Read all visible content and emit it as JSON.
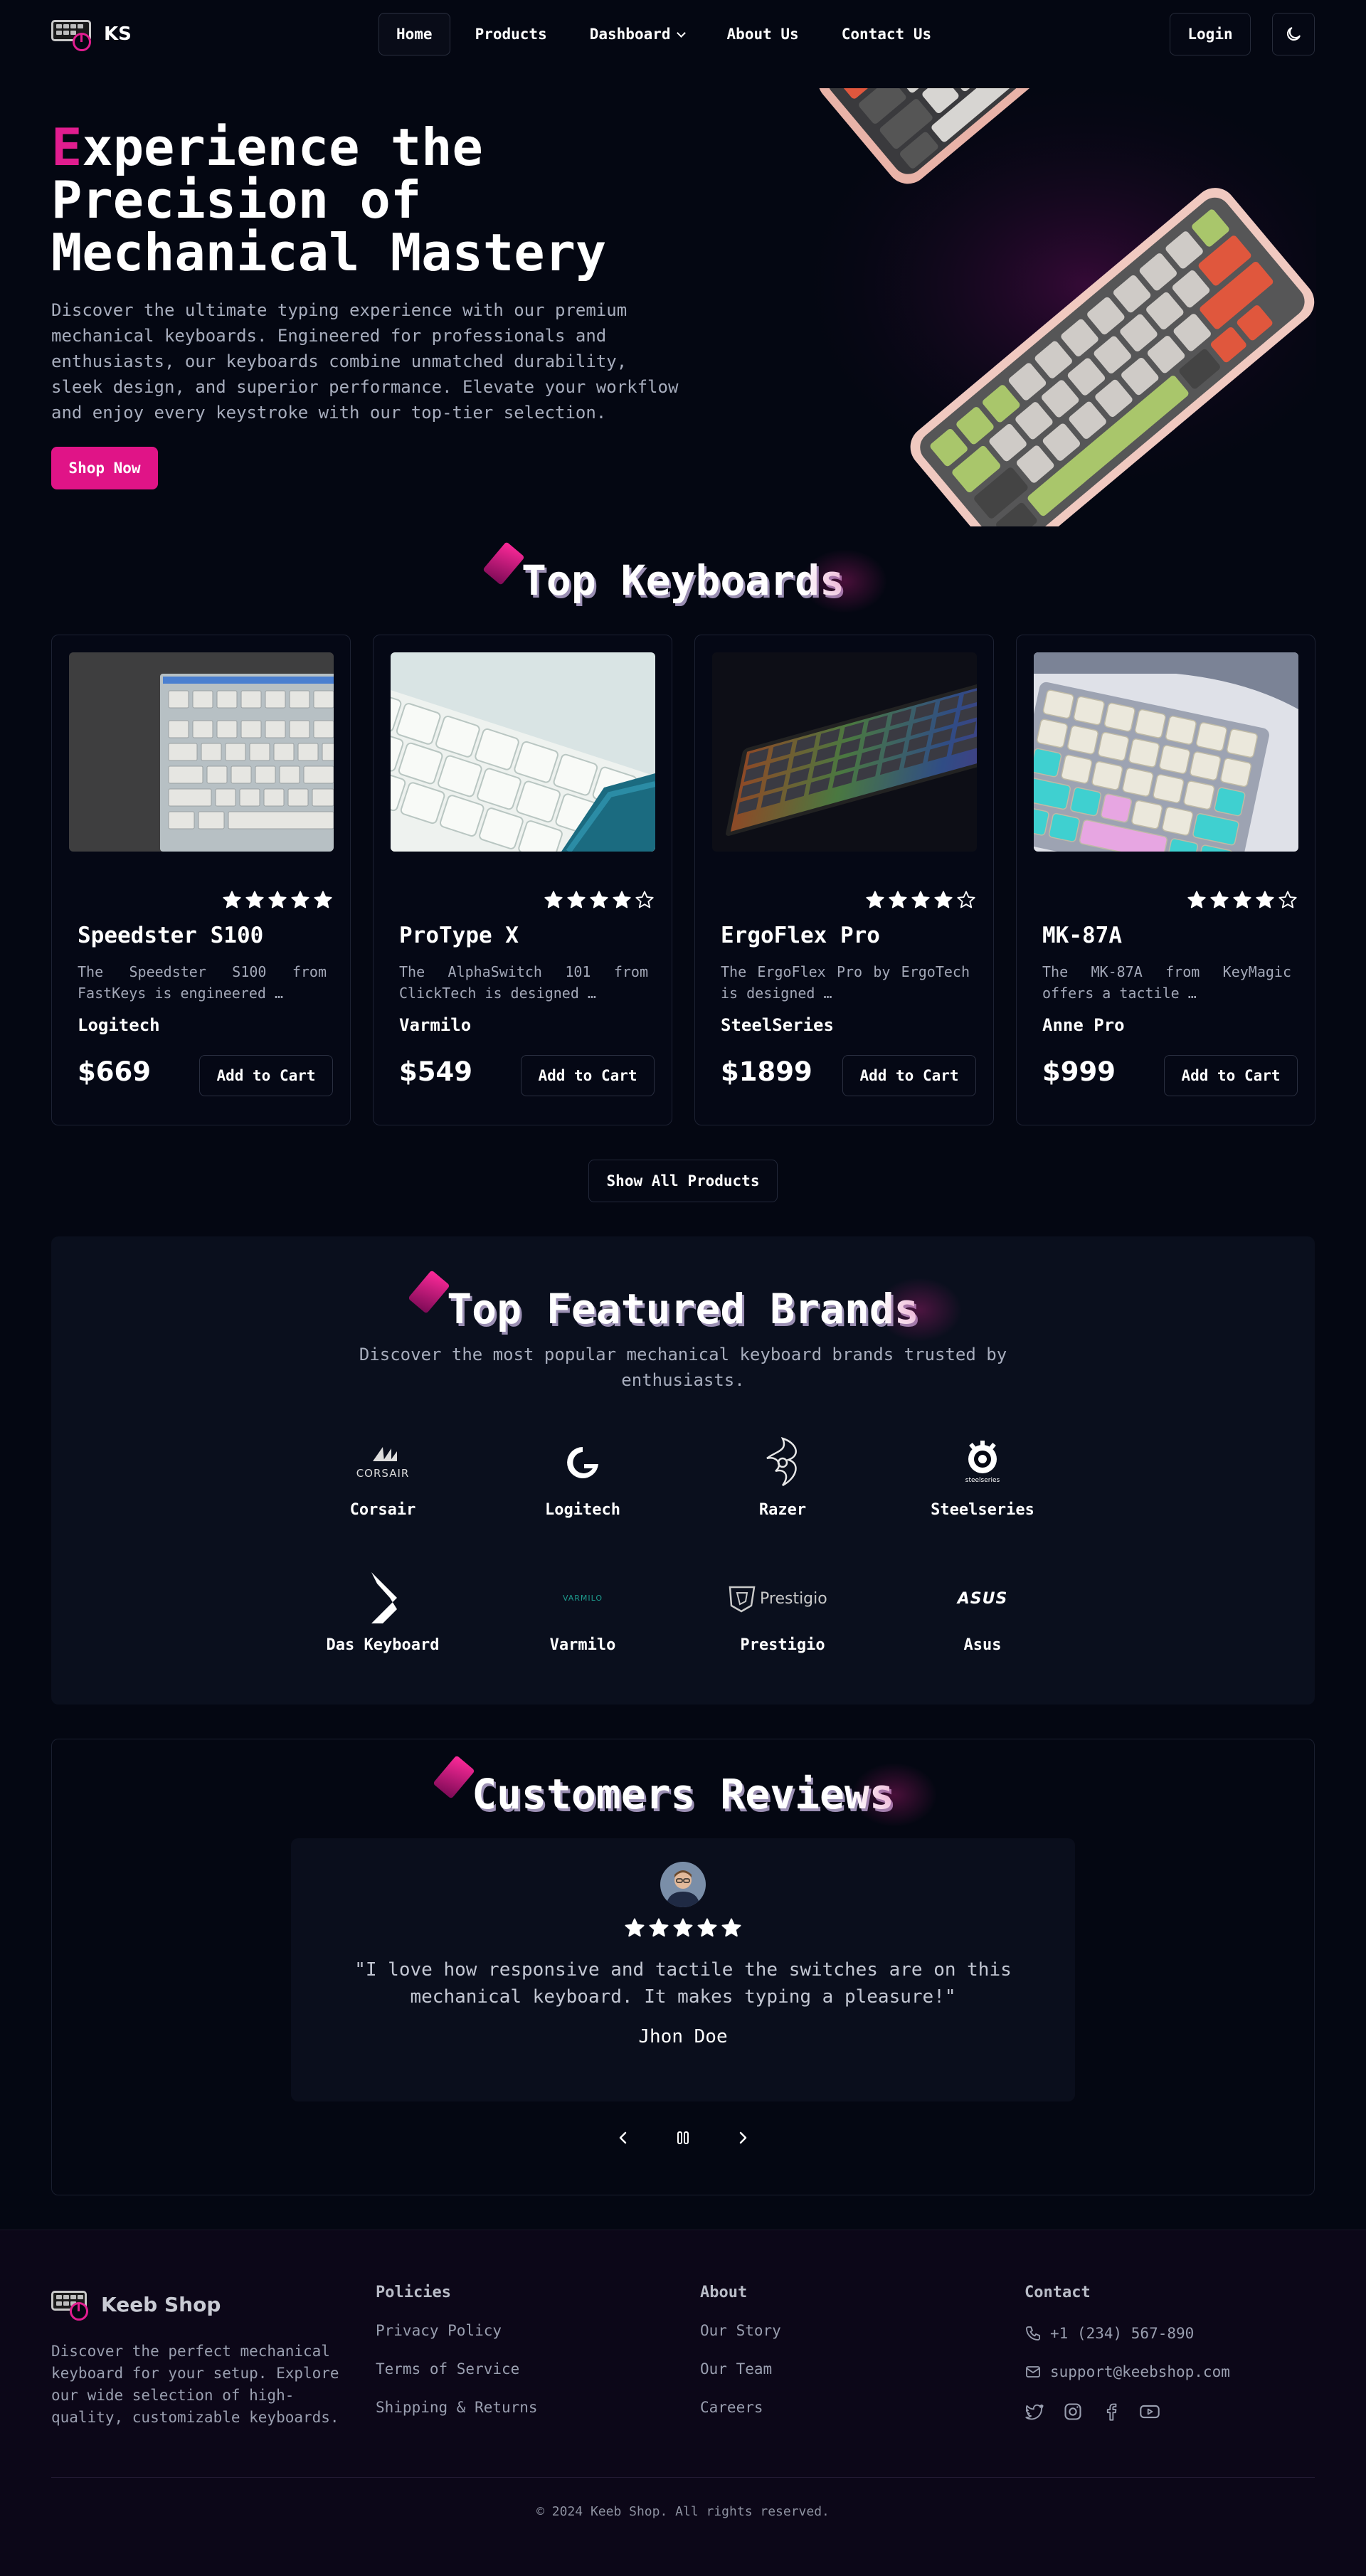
{
  "nav": {
    "brand": "KS",
    "items": [
      {
        "label": "Home"
      },
      {
        "label": "Products"
      },
      {
        "label": "Dashboard"
      },
      {
        "label": "About Us"
      },
      {
        "label": "Contact Us"
      }
    ],
    "login": "Login",
    "theme_icon": "moon-icon"
  },
  "hero": {
    "title_first": "E",
    "title_rest": "xperience the Precision of Mechanical Mastery",
    "description": "Discover the ultimate typing experience with our premium mechanical keyboards. Engineered for professionals and enthusiasts, our keyboards combine unmatched durability, sleek design, and superior performance. Elevate your workflow and enjoy every keystroke with our top-tier selection.",
    "cta": "Shop Now"
  },
  "products": {
    "title": "Top Keyboards",
    "show_all": "Show All Products",
    "cart_label": "Add to Cart",
    "items": [
      {
        "name": "Speedster S100",
        "desc": "The Speedster S100 from FastKeys is engineered …",
        "brand": "Logitech",
        "price": "$669",
        "rating": 5
      },
      {
        "name": "ProType X",
        "desc": "The AlphaSwitch 101 from ClickTech is designed …",
        "brand": "Varmilo",
        "price": "$549",
        "rating": 4
      },
      {
        "name": "ErgoFlex Pro",
        "desc": "The ErgoFlex Pro by ErgoTech is designed …",
        "brand": "SteelSeries",
        "price": "$1899",
        "rating": 4
      },
      {
        "name": "MK-87A",
        "desc": "The MK-87A from KeyMagic offers a tactile …",
        "brand": "Anne Pro",
        "price": "$999",
        "rating": 4
      }
    ]
  },
  "brands": {
    "title": "Top Featured Brands",
    "subtitle": "Discover the most popular mechanical keyboard brands trusted by enthusiasts.",
    "items": [
      {
        "name": "Corsair",
        "logo_text": "CORSAIR"
      },
      {
        "name": "Logitech"
      },
      {
        "name": "Razer"
      },
      {
        "name": "Steelseries",
        "logo_text": "steelseries"
      },
      {
        "name": "Das Keyboard"
      },
      {
        "name": "Varmilo",
        "logo_text": "VARMILO"
      },
      {
        "name": "Prestigio",
        "logo_text": "Prestigio"
      },
      {
        "name": "Asus",
        "logo_text": "ASUS"
      }
    ]
  },
  "reviews": {
    "title": "Customers Reviews",
    "rating": 5,
    "quote": "\"I love how responsive and tactile the switches are on this mechanical keyboard. It makes typing a pleasure!\"",
    "author": "Jhon Doe"
  },
  "footer": {
    "brand": "Keeb Shop",
    "description": "Discover the perfect mechanical keyboard for your setup. Explore our wide selection of high-quality, customizable keyboards.",
    "policies": {
      "title": "Policies",
      "links": [
        "Privacy Policy",
        "Terms of Service",
        "Shipping & Returns"
      ]
    },
    "about": {
      "title": "About",
      "links": [
        "Our Story",
        "Our Team",
        "Careers"
      ]
    },
    "contact": {
      "title": "Contact",
      "phone": "+1 (234) 567-890",
      "email": "support@keebshop.com"
    },
    "copyright": "© 2024 Keeb Shop. All rights reserved."
  },
  "colors": {
    "accent": "#e01487",
    "background": "#040712",
    "panel": "#0a0f1d"
  }
}
